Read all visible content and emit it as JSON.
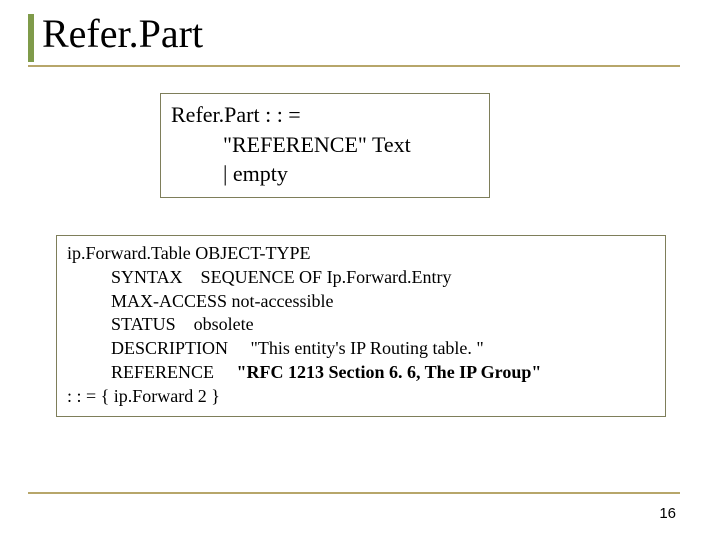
{
  "title": "Refer.Part",
  "grammar": {
    "line1": "Refer.Part : : =",
    "line2": "\"REFERENCE\" Text",
    "line3": "| empty"
  },
  "code": {
    "l1": "ip.Forward.Table OBJECT-TYPE",
    "l2": "SYNTAX    SEQUENCE OF Ip.Forward.Entry",
    "l3": "MAX-ACCESS not-accessible",
    "l4": "STATUS    obsolete",
    "l5": "DESCRIPTION     \"This entity's IP Routing table. \"",
    "l6a": "REFERENCE     ",
    "l6b": "\"RFC 1213 Section 6. 6, The IP Group\"",
    "l7": ": : = { ip.Forward 2 }"
  },
  "pageNumber": "16"
}
